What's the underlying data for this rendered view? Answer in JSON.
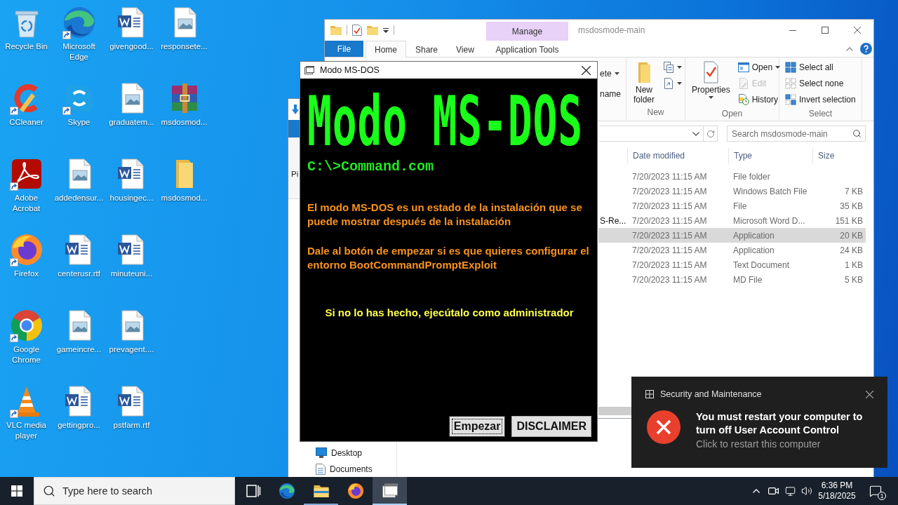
{
  "desktop_icons": [
    {
      "label": "Recycle Bin",
      "kind": "recycle",
      "shortcut": false
    },
    {
      "label": "CCleaner",
      "kind": "ccleaner",
      "shortcut": true
    },
    {
      "label": "Adobe Acrobat",
      "kind": "acrobat",
      "shortcut": true
    },
    {
      "label": "Firefox",
      "kind": "firefox",
      "shortcut": true
    },
    {
      "label": "Google Chrome",
      "kind": "chrome",
      "shortcut": true
    },
    {
      "label": "VLC media player",
      "kind": "vlc",
      "shortcut": true
    },
    {
      "label": "Microsoft Edge",
      "kind": "edge",
      "shortcut": true
    },
    {
      "label": "Skype",
      "kind": "skype",
      "shortcut": true
    },
    {
      "label": "addedensur...",
      "kind": "image",
      "shortcut": false
    },
    {
      "label": "centerusr.rtf",
      "kind": "word",
      "shortcut": false
    },
    {
      "label": "gameincre...",
      "kind": "image",
      "shortcut": false
    },
    {
      "label": "gettingpro...",
      "kind": "word",
      "shortcut": false
    },
    {
      "label": "givengood...",
      "kind": "word",
      "shortcut": false
    },
    {
      "label": "graduatem...",
      "kind": "image",
      "shortcut": false
    },
    {
      "label": "housingec...",
      "kind": "word",
      "shortcut": false
    },
    {
      "label": "minuteuni...",
      "kind": "word",
      "shortcut": false
    },
    {
      "label": "prevagent....",
      "kind": "image",
      "shortcut": false
    },
    {
      "label": "pstfarm.rtf",
      "kind": "word",
      "shortcut": false
    },
    {
      "label": "responsete...",
      "kind": "image",
      "shortcut": false
    },
    {
      "label": "msdosmod...",
      "kind": "archive",
      "shortcut": false
    },
    {
      "label": "msdosmod...",
      "kind": "folder",
      "shortcut": false
    }
  ],
  "back_window": {
    "ribbon_label": "Pi",
    "nav_items": [
      {
        "label": "Desktop",
        "kind": "desktop"
      },
      {
        "label": "Documents",
        "kind": "documents"
      }
    ]
  },
  "explorer": {
    "title": "msdosmode-main",
    "context_header": "Manage",
    "tabs": [
      {
        "label": "File",
        "kind": "menu",
        "selected": false
      },
      {
        "label": "Home",
        "kind": "tab",
        "selected": true
      },
      {
        "label": "Share",
        "kind": "tab",
        "selected": false
      },
      {
        "label": "View",
        "kind": "tab",
        "selected": false
      },
      {
        "label": "Application Tools",
        "kind": "context",
        "selected": false
      }
    ],
    "ribbon_clipped": [
      {
        "label": "ete",
        "caret": true
      },
      {
        "label": "name",
        "caret": false
      }
    ],
    "ribbon_groups": [
      {
        "label": "New",
        "large": [
          {
            "label": "New folder",
            "kind": "new-folder",
            "caret": false
          }
        ],
        "small": [
          {
            "kind": "new-item",
            "caret": true,
            "disabled": false
          },
          {
            "kind": "easy-access",
            "caret": true,
            "disabled": false
          }
        ]
      },
      {
        "label": "Open",
        "large": [
          {
            "label": "Properties",
            "kind": "properties",
            "caret": true
          }
        ],
        "small": [
          {
            "label": "Open",
            "kind": "open",
            "caret": true,
            "disabled": false
          },
          {
            "label": "Edit",
            "kind": "edit",
            "caret": false,
            "disabled": true
          },
          {
            "label": "History",
            "kind": "history",
            "caret": false,
            "disabled": false
          }
        ]
      },
      {
        "label": "Select",
        "small": [
          {
            "label": "Select all",
            "kind": "select-all",
            "caret": false,
            "disabled": false
          },
          {
            "label": "Select none",
            "kind": "select-none",
            "caret": false,
            "disabled": false
          },
          {
            "label": "Invert selection",
            "kind": "invert",
            "caret": false,
            "disabled": false
          }
        ]
      }
    ],
    "search_placeholder": "Search msdosmode-main",
    "columns": [
      {
        "label": "Date modified"
      },
      {
        "label": "Type"
      },
      {
        "label": "Size"
      }
    ],
    "rows": [
      {
        "date": "7/20/2023 11:15 AM",
        "type": "File folder",
        "selected": false
      },
      {
        "date": "7/20/2023 11:15 AM",
        "type": "Windows Batch File",
        "size": "7 KB",
        "selected": false
      },
      {
        "date": "7/20/2023 11:15 AM",
        "type": "File",
        "size": "35 KB",
        "selected": false
      },
      {
        "name": "S-Re...",
        "date": "7/20/2023 11:15 AM",
        "type": "Microsoft Word D...",
        "size": "151 KB",
        "selected": false
      },
      {
        "date": "7/20/2023 11:15 AM",
        "type": "Application",
        "size": "20 KB",
        "selected": true
      },
      {
        "date": "7/20/2023 11:15 AM",
        "type": "Application",
        "size": "24 KB",
        "selected": false
      },
      {
        "date": "7/20/2023 11:15 AM",
        "type": "Text Document",
        "size": "1 KB",
        "selected": false
      },
      {
        "date": "7/20/2023 11:15 AM",
        "type": "MD File",
        "size": "5 KB",
        "selected": false
      }
    ]
  },
  "dialog": {
    "title": "Modo MS-DOS",
    "heading": "Modo MS-DOS",
    "command": "C:\\>Command.com",
    "paragraphs": [
      "El modo MS-DOS es un estado de la instalación que se puede mostrar después de la instalación",
      "Dale al botón de empezar si es que quieres configurar el entorno BootCommandPromptExploit"
    ],
    "notice": "Si no lo has hecho, ejecútalo como administrador",
    "buttons": [
      {
        "label": "Empezar",
        "focused": true
      },
      {
        "label": "DISCLAIMER",
        "focused": false
      }
    ]
  },
  "notification": {
    "app": "Security and Maintenance",
    "title": "You must restart your computer to turn off User Account Control",
    "body": "Click to restart this computer"
  },
  "taskbar": {
    "search_placeholder": "Type here to search",
    "apps": [
      {
        "kind": "task-view",
        "running": false,
        "selected": false
      },
      {
        "kind": "edge",
        "running": false,
        "selected": false
      },
      {
        "kind": "explorer",
        "running": true,
        "selected": false
      },
      {
        "kind": "firefox",
        "running": false,
        "selected": false
      },
      {
        "kind": "dialog",
        "running": true,
        "selected": true
      }
    ],
    "time": "6:36 PM",
    "date": "5/18/2025",
    "notification_count": "1"
  }
}
